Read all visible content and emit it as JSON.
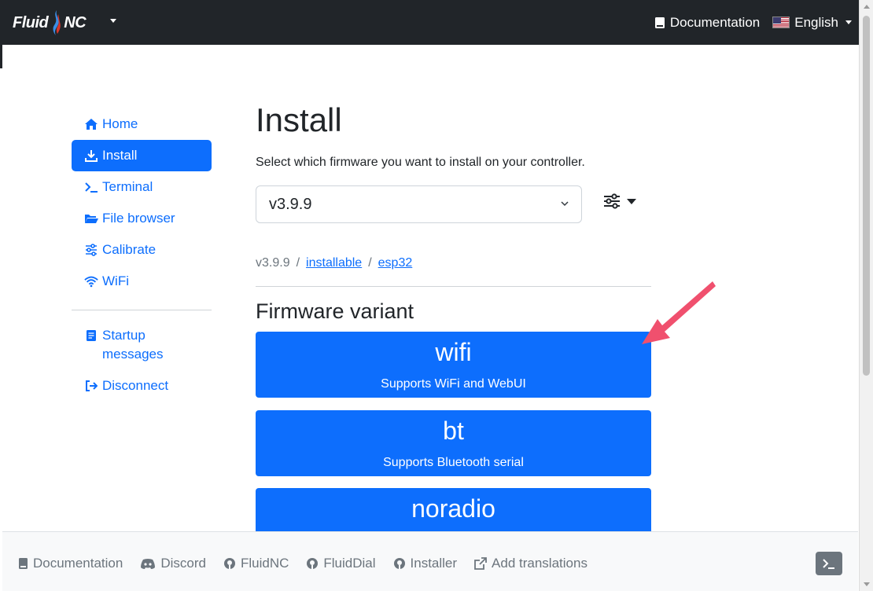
{
  "navbar": {
    "brand_left": "Fluid",
    "brand_right": "NC",
    "documentation": "Documentation",
    "language": "English"
  },
  "sidebar": {
    "items": [
      {
        "label": "Home",
        "icon": "home-icon"
      },
      {
        "label": "Install",
        "icon": "download-icon"
      },
      {
        "label": "Terminal",
        "icon": "terminal-icon"
      },
      {
        "label": "File browser",
        "icon": "folder-open-icon"
      },
      {
        "label": "Calibrate",
        "icon": "sliders-icon"
      },
      {
        "label": "WiFi",
        "icon": "wifi-icon"
      }
    ],
    "startup_line1": "Startup",
    "startup_line2": "messages",
    "disconnect": "Disconnect"
  },
  "main": {
    "title": "Install",
    "lead": "Select which firmware you want to install on your controller.",
    "selected_version": "v3.9.9",
    "breadcrumb": {
      "version": "v3.9.9",
      "sep": "/",
      "link1": "installable",
      "link2": "esp32"
    },
    "section_title": "Firmware variant",
    "variants": [
      {
        "name": "wifi",
        "desc": "Supports WiFi and WebUI"
      },
      {
        "name": "bt",
        "desc": "Supports Bluetooth serial"
      },
      {
        "name": "noradio",
        "desc": ""
      }
    ]
  },
  "footer": {
    "links": [
      "Documentation",
      "Discord",
      "FluidNC",
      "FluidDial",
      "Installer",
      "Add translations"
    ]
  },
  "colors": {
    "primary": "#0d6efd",
    "navbar": "#212529",
    "annotation_arrow": "#f0506e"
  }
}
